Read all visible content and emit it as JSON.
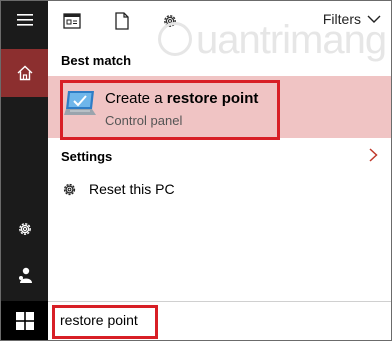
{
  "toolbar": {
    "filters_label": "Filters"
  },
  "watermark": {
    "text": "uantrimang"
  },
  "results": {
    "best_match_header": "Best match",
    "best_match": {
      "title_prefix": "Create a ",
      "title_bold": "restore point",
      "subtitle": "Control panel"
    },
    "settings_header": "Settings",
    "settings_items": [
      {
        "label": "Reset this PC"
      }
    ]
  },
  "search": {
    "value": "restore point"
  },
  "colors": {
    "rail": "#1b1b1b",
    "home_active": "#8c2f2f",
    "best_highlight": "#f0c4c4",
    "annotation": "#d81f26",
    "chevron": "#c0392b"
  },
  "icons": {
    "menu": "hamburger-icon",
    "home": "home-icon",
    "gear": "gear-icon",
    "user": "user-icon",
    "start": "windows-logo-icon",
    "apps": "apps-icon",
    "documents": "document-icon",
    "settings": "settings-icon",
    "filters": "chevron-down-icon",
    "best_match": "restore-point-icon",
    "expand": "chevron-right-icon",
    "reset": "gear-icon"
  }
}
